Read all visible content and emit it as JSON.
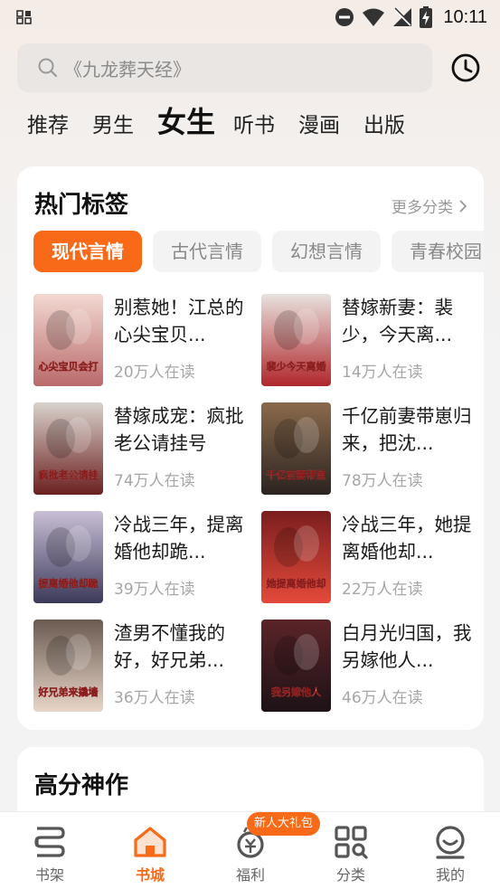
{
  "status_bar": {
    "time": "10:11"
  },
  "search": {
    "placeholder": "《九龙葬天经》"
  },
  "tabs": [
    {
      "label": "推荐",
      "active": false
    },
    {
      "label": "男生",
      "active": false
    },
    {
      "label": "女生",
      "active": true
    },
    {
      "label": "听书",
      "active": false
    },
    {
      "label": "漫画",
      "active": false
    },
    {
      "label": "出版",
      "active": false
    }
  ],
  "hot_tags": {
    "title": "热门标签",
    "more": "更多分类",
    "tags": [
      {
        "label": "现代言情",
        "active": true
      },
      {
        "label": "古代言情",
        "active": false
      },
      {
        "label": "幻想言情",
        "active": false
      },
      {
        "label": "青春校园",
        "active": false
      }
    ],
    "books": [
      {
        "title": "别惹她！江总的心尖宝贝...",
        "readers": "20万人在读",
        "cover_text": "心尖宝贝会打架",
        "cover_colors": [
          "#f3d9d2",
          "#b96a6a"
        ]
      },
      {
        "title": "替嫁新妻：裴少，今天离...",
        "readers": "14万人在读",
        "cover_text": "裴少今天离婚吗",
        "cover_colors": [
          "#e8e2de",
          "#b0272c"
        ]
      },
      {
        "title": "替嫁成宠：疯批老公请挂号",
        "readers": "74万人在读",
        "cover_text": "疯批老公请挂号",
        "cover_colors": [
          "#d9d2cc",
          "#6b2020"
        ]
      },
      {
        "title": "千亿前妻带崽归来，把沈...",
        "readers": "78万人在读",
        "cover_text": "千亿前妻带崽归来",
        "cover_colors": [
          "#8a6a4c",
          "#2b2320"
        ]
      },
      {
        "title": "冷战三年，提离婚他却跪...",
        "readers": "39万人在读",
        "cover_text": "提离婚他却跪下了",
        "cover_colors": [
          "#c9bfd6",
          "#3c3a5a"
        ]
      },
      {
        "title": "冷战三年，她提离婚他却...",
        "readers": "22万人在读",
        "cover_text": "她提离婚他却红了眼",
        "cover_colors": [
          "#7a1e1e",
          "#e54a3a"
        ]
      },
      {
        "title": "渣男不懂我的好，好兄弟...",
        "readers": "36万人在读",
        "cover_text": "好兄弟来撬墙角",
        "cover_colors": [
          "#6a5a50",
          "#e8d6c8"
        ]
      },
      {
        "title": "白月光归国，我另嫁他人...",
        "readers": "46万人在读",
        "cover_text": "我另嫁他人",
        "cover_colors": [
          "#5a2428",
          "#1d1216"
        ]
      }
    ]
  },
  "high_score": {
    "title": "高分神作"
  },
  "bottom_nav": {
    "gift_badge": "新人大礼包",
    "items": [
      {
        "label": "书架",
        "icon": "bookshelf-icon",
        "active": false
      },
      {
        "label": "书城",
        "icon": "bookstore-icon",
        "active": true
      },
      {
        "label": "福利",
        "icon": "welfare-icon",
        "active": false
      },
      {
        "label": "分类",
        "icon": "category-icon",
        "active": false
      },
      {
        "label": "我的",
        "icon": "profile-icon",
        "active": false
      }
    ]
  },
  "colors": {
    "accent": "#f86a17"
  }
}
